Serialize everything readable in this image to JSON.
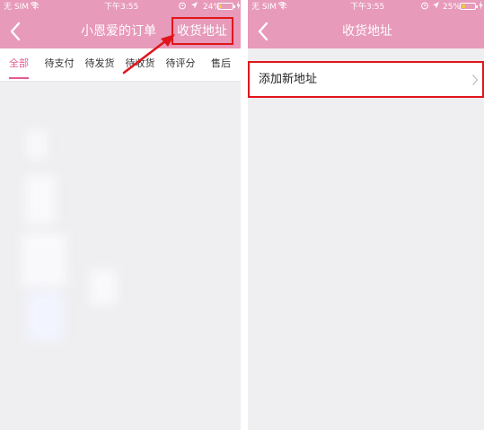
{
  "left_screen": {
    "status": {
      "carrier": "无 SIM 卡",
      "time": "下午3:55",
      "battery": "24%",
      "battery_level": 0.24
    },
    "nav": {
      "title": "小恩爱的订单",
      "action": "收货地址",
      "back_icon": "chevron-left-icon"
    },
    "tabs": [
      {
        "label": "全部",
        "active": true
      },
      {
        "label": "待支付"
      },
      {
        "label": "待发货"
      },
      {
        "label": "待收货"
      },
      {
        "label": "待评分"
      },
      {
        "label": "售后"
      }
    ]
  },
  "right_screen": {
    "status": {
      "carrier": "无 SIM 卡",
      "time": "下午3:55",
      "battery": "25%",
      "battery_level": 0.25
    },
    "nav": {
      "title": "收货地址",
      "back_icon": "chevron-left-icon"
    },
    "add_address": {
      "label": "添加新地址",
      "icon": "chevron-right-icon"
    }
  },
  "colors": {
    "nav_pink": "#e79ab9",
    "accent_pink": "#e45b94",
    "highlight_red": "#e0161c",
    "background": "#efeff1"
  }
}
